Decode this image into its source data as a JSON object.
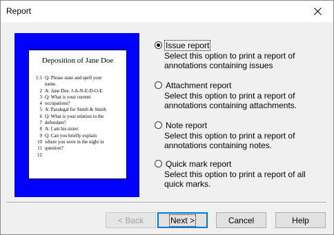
{
  "window": {
    "title": "Report"
  },
  "preview": {
    "doc_title": "Deposition of  Jane Doe",
    "lines": [
      {
        "num": "1:1",
        "text": "Q: Please state and spell your"
      },
      {
        "num": "",
        "text": "name."
      },
      {
        "num": "2",
        "text": "A: Jane Doe. J-A-N-E-D-O-E"
      },
      {
        "num": "3",
        "text": "Q: What is your current"
      },
      {
        "num": "4",
        "text": "occupations?"
      },
      {
        "num": "5",
        "text": "A: Paralegal for Smith & Smith"
      },
      {
        "num": "6",
        "text": "Q: What is your relation to the"
      },
      {
        "num": "7",
        "text": "defendant?"
      },
      {
        "num": "8",
        "text": "A: I am his sister."
      },
      {
        "num": "9",
        "text": "Q: Can you briefly explain"
      },
      {
        "num": "10",
        "text": "where you were in the night in"
      },
      {
        "num": "11",
        "text": "question?"
      },
      {
        "num": "12",
        "text": ""
      }
    ]
  },
  "options": [
    {
      "label": "Issue report",
      "description": "Select this option to print a report of annotations containing issues",
      "checked": true
    },
    {
      "label": "Attachment report",
      "description": "Select this option to print a report of annotations containing attachments.",
      "checked": false
    },
    {
      "label": "Note report",
      "description": "Select this option to print a report of annotations containing notes.",
      "checked": false
    },
    {
      "label": "Quick mark report",
      "description": "Select this option to print a report of all quick marks.",
      "checked": false
    }
  ],
  "buttons": {
    "back": "< Back",
    "next": "Next >",
    "cancel": "Cancel",
    "help": "Help"
  }
}
